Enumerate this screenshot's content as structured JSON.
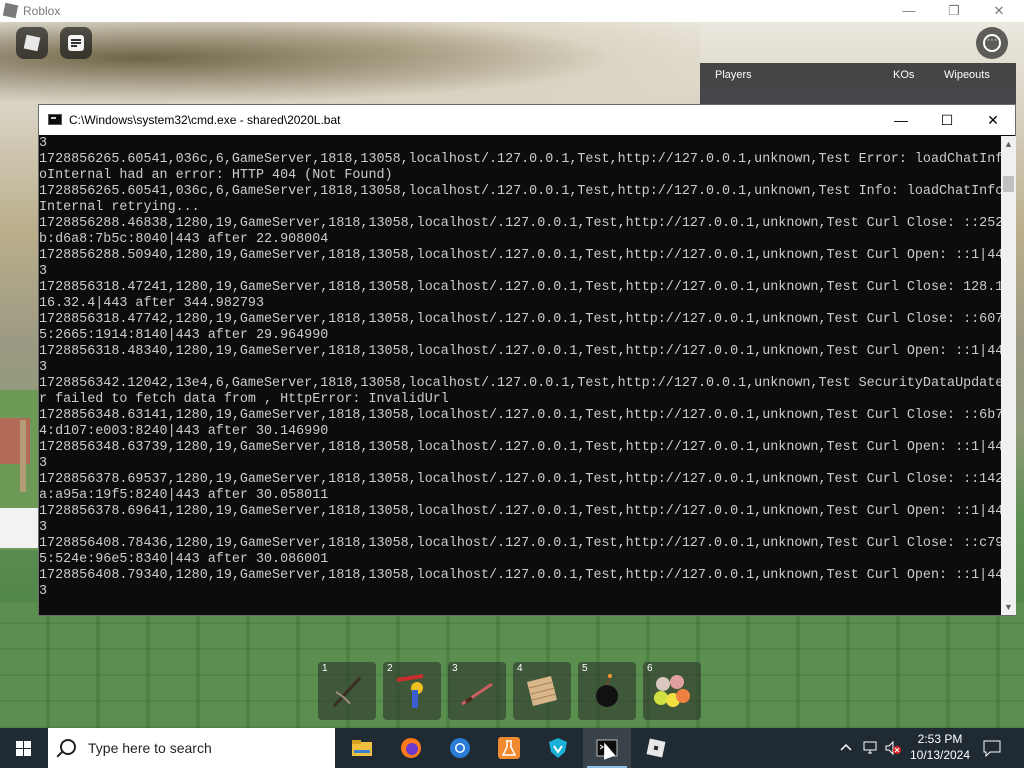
{
  "app": {
    "title": "Roblox",
    "window_controls": {
      "minimize": "—",
      "restore": "❐",
      "close": "✕"
    }
  },
  "roblox_ui": {
    "top_buttons": [
      "roblox-menu",
      "chat",
      "more"
    ],
    "leaderboard": {
      "headers": [
        "Players",
        "KOs",
        "Wipeouts"
      ]
    }
  },
  "cmd": {
    "title": "C:\\Windows\\system32\\cmd.exe - shared\\2020L.bat",
    "controls": {
      "minimize": "—",
      "maximize": "☐",
      "close": "✕"
    },
    "lines": [
      "3",
      "1728856265.60541,036c,6,GameServer,1818,13058,localhost/.127.0.0.1,Test,http://127.0.0.1,unknown,Test Error: loadChatInfo",
      "oInternal had an error: HTTP 404 (Not Found)",
      "1728856265.60541,036c,6,GameServer,1818,13058,localhost/.127.0.0.1,Test,http://127.0.0.1,unknown,Test Info: loadChatInfo",
      "Internal retrying...",
      "1728856288.46838,1280,19,GameServer,1818,13058,localhost/.127.0.0.1,Test,http://127.0.0.1,unknown,Test Curl Close: ::252",
      "b:d6a8:7b5c:8040|443 after 22.908004",
      "1728856288.50940,1280,19,GameServer,1818,13058,localhost/.127.0.0.1,Test,http://127.0.0.1,unknown,Test Curl Open: ::1|44",
      "3",
      "1728856318.47241,1280,19,GameServer,1818,13058,localhost/.127.0.0.1,Test,http://127.0.0.1,unknown,Test Curl Close: 128.1",
      "16.32.4|443 after 344.982793",
      "1728856318.47742,1280,19,GameServer,1818,13058,localhost/.127.0.0.1,Test,http://127.0.0.1,unknown,Test Curl Close: ::607",
      "5:2665:1914:8140|443 after 29.964990",
      "1728856318.48340,1280,19,GameServer,1818,13058,localhost/.127.0.0.1,Test,http://127.0.0.1,unknown,Test Curl Open: ::1|44",
      "3",
      "1728856342.12042,13e4,6,GameServer,1818,13058,localhost/.127.0.0.1,Test,http://127.0.0.1,unknown,Test SecurityDataUpdate",
      "r failed to fetch data from , HttpError: InvalidUrl",
      "1728856348.63141,1280,19,GameServer,1818,13058,localhost/.127.0.0.1,Test,http://127.0.0.1,unknown,Test Curl Close: ::6b7",
      "4:d107:e003:8240|443 after 30.146990",
      "1728856348.63739,1280,19,GameServer,1818,13058,localhost/.127.0.0.1,Test,http://127.0.0.1,unknown,Test Curl Open: ::1|44",
      "3",
      "1728856378.69537,1280,19,GameServer,1818,13058,localhost/.127.0.0.1,Test,http://127.0.0.1,unknown,Test Curl Close: ::142",
      "a:a95a:19f5:8240|443 after 30.058011",
      "1728856378.69641,1280,19,GameServer,1818,13058,localhost/.127.0.0.1,Test,http://127.0.0.1,unknown,Test Curl Open: ::1|44",
      "3",
      "1728856408.78436,1280,19,GameServer,1818,13058,localhost/.127.0.0.1,Test,http://127.0.0.1,unknown,Test Curl Close: ::c79",
      "5:524e:96e5:8340|443 after 30.086001",
      "1728856408.79340,1280,19,GameServer,1818,13058,localhost/.127.0.0.1,Test,http://127.0.0.1,unknown,Test Curl Open: ::1|44",
      "3"
    ]
  },
  "hotbar": {
    "slots": [
      {
        "num": "1",
        "icon": "slingshot-icon"
      },
      {
        "num": "2",
        "icon": "superball-icon"
      },
      {
        "num": "3",
        "icon": "sword-icon"
      },
      {
        "num": "4",
        "icon": "wall-icon"
      },
      {
        "num": "5",
        "icon": "bomb-icon"
      },
      {
        "num": "6",
        "icon": "paintball-icon"
      }
    ]
  },
  "taskbar": {
    "search_placeholder": "Type here to search",
    "apps": [
      "file-explorer-icon",
      "firefox-icon",
      "chrome-icon",
      "lab-flask-icon",
      "vpn-icon",
      "cmd-icon",
      "roblox-icon"
    ],
    "active_app": "cmd-icon",
    "time": "2:53 PM",
    "date": "10/13/2024"
  },
  "colors": {
    "console_bg": "#0c0c0c",
    "console_text": "#cccccc",
    "taskbar_bg": "#1f2a32"
  }
}
